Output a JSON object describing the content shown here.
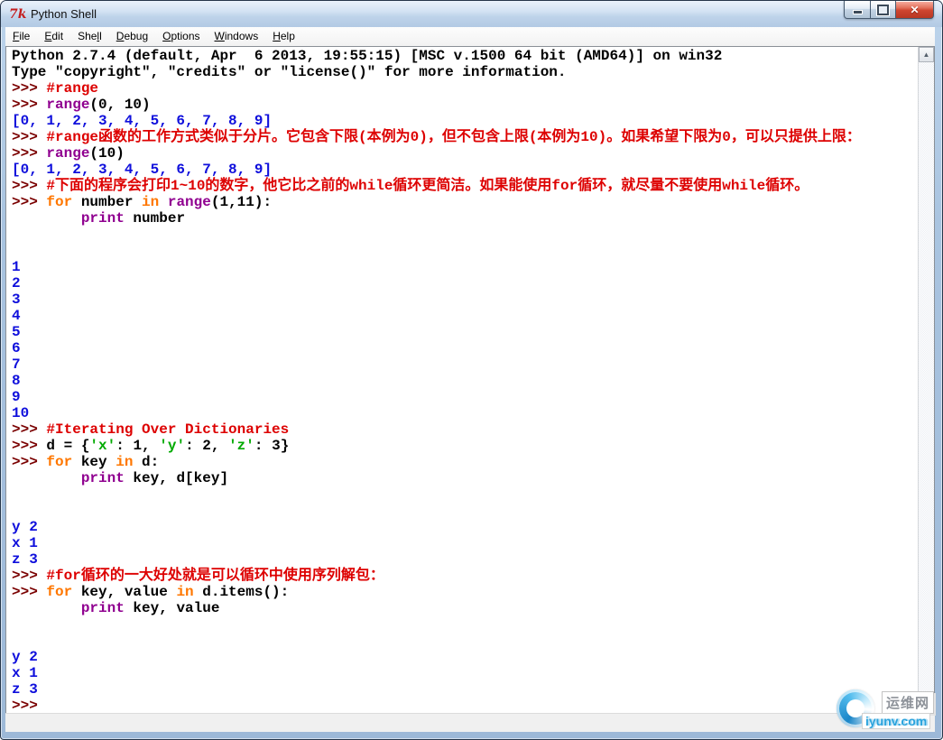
{
  "window": {
    "title": "Python Shell",
    "icon": "tk-logo",
    "controls": {
      "minimize": "minimize",
      "maximize": "maximize",
      "close_glyph": "✕"
    }
  },
  "menu": {
    "items": [
      {
        "label": "File",
        "underline": 0
      },
      {
        "label": "Edit",
        "underline": 0
      },
      {
        "label": "Shell",
        "underline": 3
      },
      {
        "label": "Debug",
        "underline": 0
      },
      {
        "label": "Options",
        "underline": 0
      },
      {
        "label": "Windows",
        "underline": 0
      },
      {
        "label": "Help",
        "underline": 0
      }
    ]
  },
  "colors": {
    "tokens": {
      "p": "#7a0000",
      "c": "#dd0000",
      "k": "#ff7700",
      "b": "#900090",
      "s": "#00aa00",
      "o": "#0f0fdc",
      "t": "#000000"
    },
    "close_button": "#cf4530",
    "titlebar": "#d3e2f3",
    "watermark_blue": "#2aa3dd"
  },
  "scrollbar": {
    "up_glyph": "▲",
    "down_glyph": "▼"
  },
  "shell": {
    "lines": [
      [
        [
          "t",
          "Python 2.7.4 (default, Apr  6 2013, 19:55:15) [MSC v.1500 64 bit (AMD64)] on win32"
        ]
      ],
      [
        [
          "t",
          "Type \"copyright\", \"credits\" or \"license()\" for more information."
        ]
      ],
      [
        [
          "p",
          ">>> "
        ],
        [
          "c",
          "#range"
        ]
      ],
      [
        [
          "p",
          ">>> "
        ],
        [
          "b",
          "range"
        ],
        [
          "t",
          "(0, 10)"
        ]
      ],
      [
        [
          "o",
          "[0, 1, 2, 3, 4, 5, 6, 7, 8, 9]"
        ]
      ],
      [
        [
          "p",
          ">>> "
        ],
        [
          "c",
          "#range函数的工作方式类似于分片。它包含下限(本例为0)，但不包含上限(本例为10)。如果希望下限为0，可以只提供上限："
        ]
      ],
      [
        [
          "p",
          ">>> "
        ],
        [
          "b",
          "range"
        ],
        [
          "t",
          "(10)"
        ]
      ],
      [
        [
          "o",
          "[0, 1, 2, 3, 4, 5, 6, 7, 8, 9]"
        ]
      ],
      [
        [
          "p",
          ">>> "
        ],
        [
          "c",
          "#下面的程序会打印1~10的数字，他它比之前的while循环更简洁。如果能使用for循环，就尽量不要使用while循环。"
        ]
      ],
      [
        [
          "p",
          ">>> "
        ],
        [
          "k",
          "for"
        ],
        [
          "t",
          " number "
        ],
        [
          "k",
          "in"
        ],
        [
          "t",
          " "
        ],
        [
          "b",
          "range"
        ],
        [
          "t",
          "(1,11):"
        ]
      ],
      [
        [
          "t",
          "        "
        ],
        [
          "b",
          "print"
        ],
        [
          "t",
          " number"
        ]
      ],
      [],
      [],
      [
        [
          "o",
          "1"
        ]
      ],
      [
        [
          "o",
          "2"
        ]
      ],
      [
        [
          "o",
          "3"
        ]
      ],
      [
        [
          "o",
          "4"
        ]
      ],
      [
        [
          "o",
          "5"
        ]
      ],
      [
        [
          "o",
          "6"
        ]
      ],
      [
        [
          "o",
          "7"
        ]
      ],
      [
        [
          "o",
          "8"
        ]
      ],
      [
        [
          "o",
          "9"
        ]
      ],
      [
        [
          "o",
          "10"
        ]
      ],
      [
        [
          "p",
          ">>> "
        ],
        [
          "c",
          "#Iterating Over Dictionaries"
        ]
      ],
      [
        [
          "p",
          ">>> "
        ],
        [
          "t",
          "d = {"
        ],
        [
          "s",
          "'x'"
        ],
        [
          "t",
          ": 1, "
        ],
        [
          "s",
          "'y'"
        ],
        [
          "t",
          ": 2, "
        ],
        [
          "s",
          "'z'"
        ],
        [
          "t",
          ": 3}"
        ]
      ],
      [
        [
          "p",
          ">>> "
        ],
        [
          "k",
          "for"
        ],
        [
          "t",
          " key "
        ],
        [
          "k",
          "in"
        ],
        [
          "t",
          " d:"
        ]
      ],
      [
        [
          "t",
          "        "
        ],
        [
          "b",
          "print"
        ],
        [
          "t",
          " key, d[key]"
        ]
      ],
      [],
      [],
      [
        [
          "o",
          "y 2"
        ]
      ],
      [
        [
          "o",
          "x 1"
        ]
      ],
      [
        [
          "o",
          "z 3"
        ]
      ],
      [
        [
          "p",
          ">>> "
        ],
        [
          "c",
          "#for循环的一大好处就是可以循环中使用序列解包："
        ]
      ],
      [
        [
          "p",
          ">>> "
        ],
        [
          "k",
          "for"
        ],
        [
          "t",
          " key, value "
        ],
        [
          "k",
          "in"
        ],
        [
          "t",
          " d.items():"
        ]
      ],
      [
        [
          "t",
          "        "
        ],
        [
          "b",
          "print"
        ],
        [
          "t",
          " key, value"
        ]
      ],
      [],
      [],
      [
        [
          "o",
          "y 2"
        ]
      ],
      [
        [
          "o",
          "x 1"
        ]
      ],
      [
        [
          "o",
          "z 3"
        ]
      ],
      [
        [
          "p",
          ">>>"
        ]
      ]
    ]
  },
  "watermark": {
    "site_name": "运维网",
    "site_url": "iyunv.com"
  }
}
